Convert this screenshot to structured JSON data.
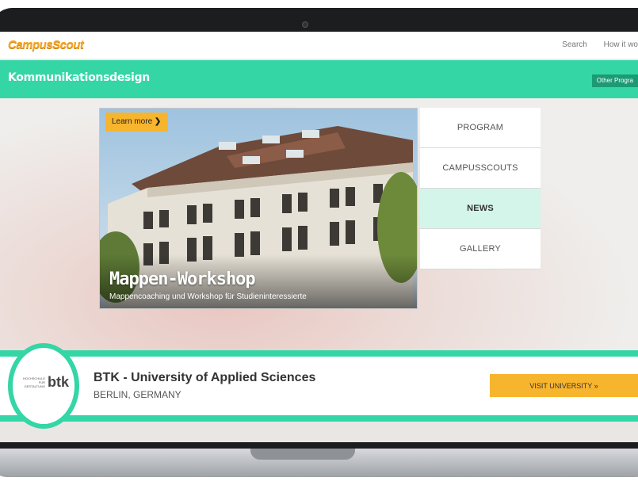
{
  "header": {
    "logo_text": "CampusScout",
    "nav": [
      "Search",
      "How it wo"
    ]
  },
  "program_bar": {
    "title": "Kommunikationsdesign",
    "other_programs": "Other Progra"
  },
  "hero": {
    "learn_more": "Learn more",
    "title": "Mappen-Workshop",
    "subtitle": "Mappencoaching und Workshop für Studieninteressierte"
  },
  "sidenav": {
    "items": [
      {
        "label": "PROGRAM"
      },
      {
        "label": "CAMPUSSCOUTS"
      },
      {
        "label": "NEWS"
      },
      {
        "label": "GALLERY"
      }
    ],
    "active_index": 2
  },
  "university": {
    "logo_small_text": "HOCHSCHULE FÜR GESTALTUNG",
    "logo_mark": "btk",
    "name": "BTK - University of Applied Sciences",
    "location": "BERLIN, GERMANY",
    "visit_button": "VISIT UNIVERSITY »"
  },
  "colors": {
    "accent_green": "#34d6a6",
    "button_yellow": "#f7b42d",
    "logo_orange": "#f6a623"
  }
}
